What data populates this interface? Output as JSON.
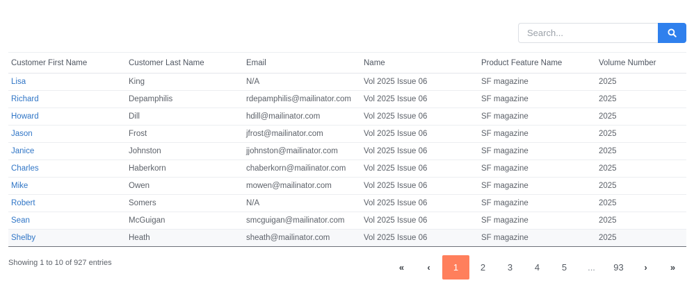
{
  "search": {
    "placeholder": "Search..."
  },
  "table": {
    "headers": [
      "Customer First Name",
      "Customer Last Name",
      "Email",
      "Name",
      "Product Feature Name",
      "Volume Number"
    ],
    "rows": [
      [
        "Lisa",
        "King",
        "N/A",
        "Vol 2025 Issue 06",
        "SF magazine",
        "2025"
      ],
      [
        "Richard",
        "Depamphilis",
        "rdepamphilis@mailinator.com",
        "Vol 2025 Issue 06",
        "SF magazine",
        "2025"
      ],
      [
        "Howard",
        "Dill",
        "hdill@mailinator.com",
        "Vol 2025 Issue 06",
        "SF magazine",
        "2025"
      ],
      [
        "Jason",
        "Frost",
        "jfrost@mailinator.com",
        "Vol 2025 Issue 06",
        "SF magazine",
        "2025"
      ],
      [
        "Janice",
        "Johnston",
        "jjohnston@mailinator.com",
        "Vol 2025 Issue 06",
        "SF magazine",
        "2025"
      ],
      [
        "Charles",
        "Haberkorn",
        "chaberkorn@mailinator.com",
        "Vol 2025 Issue 06",
        "SF magazine",
        "2025"
      ],
      [
        "Mike",
        "Owen",
        "mowen@mailinator.com",
        "Vol 2025 Issue 06",
        "SF magazine",
        "2025"
      ],
      [
        "Robert",
        "Somers",
        "N/A",
        "Vol 2025 Issue 06",
        "SF magazine",
        "2025"
      ],
      [
        "Sean",
        "McGuigan",
        "smcguigan@mailinator.com",
        "Vol 2025 Issue 06",
        "SF magazine",
        "2025"
      ],
      [
        "Shelby",
        "Heath",
        "sheath@mailinator.com",
        "Vol 2025 Issue 06",
        "SF magazine",
        "2025"
      ]
    ]
  },
  "footer": {
    "info": "Showing 1 to 10 of 927 entries"
  },
  "pagination": {
    "first_icon": "«",
    "prev_icon": "‹",
    "pages": [
      "1",
      "2",
      "3",
      "4",
      "5"
    ],
    "ellipsis": "...",
    "last_page": "93",
    "next_icon": "›",
    "last_icon": "»",
    "active_page": "1"
  },
  "colors": {
    "accent": "#2f80ed",
    "active_page": "#ff7f5c",
    "link": "#2f75c6"
  }
}
